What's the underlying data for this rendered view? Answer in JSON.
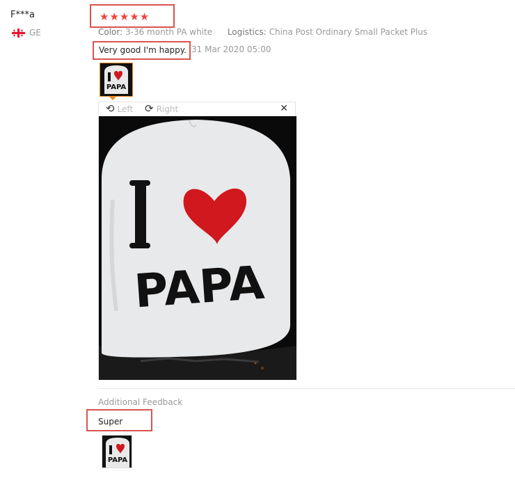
{
  "review": {
    "username": "F***a",
    "country_code": "GE",
    "stars": "★★★★★",
    "rating": 5,
    "color_label": "Color:",
    "color_value": "3-36 month PA white",
    "logistics_label": "Logistics:",
    "logistics_value": "China Post Ordinary Small Packet Plus",
    "text": "Very good I'm happy.",
    "date": "31 Mar 2020 05:00"
  },
  "image_viewer": {
    "rotate_left_label": "Left",
    "rotate_right_label": "Right",
    "close_glyph": "✕",
    "photo": {
      "print_line1": "I",
      "print_line2": "PAPA"
    }
  },
  "additional_feedback": {
    "title": "Additional Feedback",
    "text": "Super"
  },
  "colors": {
    "highlight": "#d9534f",
    "star": "#f0433a",
    "thumb_active": "#f08a24"
  }
}
